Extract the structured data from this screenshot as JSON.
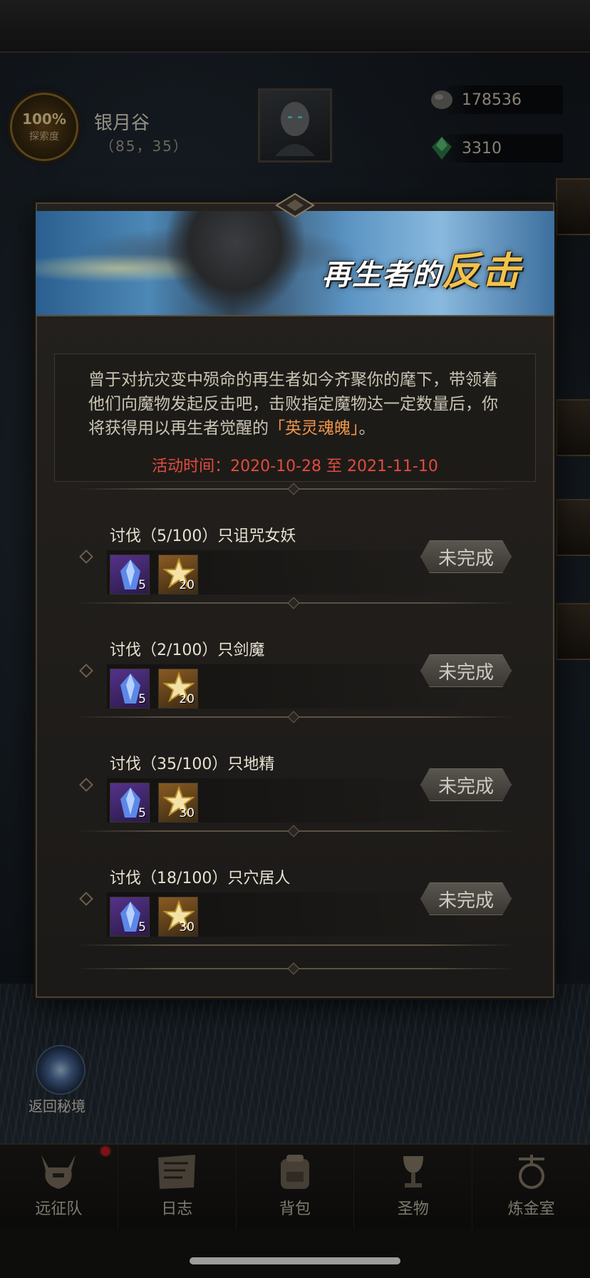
{
  "location": {
    "explore_pct": "100%",
    "explore_label": "探索度",
    "name": "银月谷",
    "coords": "（85，35）"
  },
  "resources": [
    {
      "icon": "stone-icon",
      "value": "178536"
    },
    {
      "icon": "gem-icon",
      "value": "3310"
    }
  ],
  "event": {
    "banner_title_main": "再生者",
    "banner_title_of": "的",
    "banner_title_accent": "反击",
    "desc_part1": "曾于对抗灾变中殒命的再生者如今齐聚你的麾下，带领着他们向魔物发起反击吧，击败指定魔物达一定数量后，你将获得用以再生者觉醒的",
    "desc_highlight": "「英灵魂魄」",
    "desc_end": "。",
    "time": "活动时间：2020-10-28 至 2021-11-10"
  },
  "tasks": [
    {
      "name": "讨伐（5/100）只诅咒女妖",
      "crystal_count": "5",
      "star_count": "20",
      "status": "未完成"
    },
    {
      "name": "讨伐（2/100）只剑魔",
      "crystal_count": "5",
      "star_count": "20",
      "status": "未完成"
    },
    {
      "name": "讨伐（35/100）只地精",
      "crystal_count": "5",
      "star_count": "30",
      "status": "未完成"
    },
    {
      "name": "讨伐（18/100）只穴居人",
      "crystal_count": "5",
      "star_count": "30",
      "status": "未完成"
    }
  ],
  "portal": {
    "label": "返回秘境"
  },
  "nav": [
    {
      "icon": "helmet-icon",
      "label": "远征队"
    },
    {
      "icon": "journal-icon",
      "label": "日志"
    },
    {
      "icon": "backpack-icon",
      "label": "背包"
    },
    {
      "icon": "chalice-icon",
      "label": "圣物"
    },
    {
      "icon": "alchemy-icon",
      "label": "炼金室"
    }
  ],
  "colors": {
    "highlight": "#f0954a",
    "time": "#e04c3e",
    "badge_dot": "#c21d1d"
  }
}
